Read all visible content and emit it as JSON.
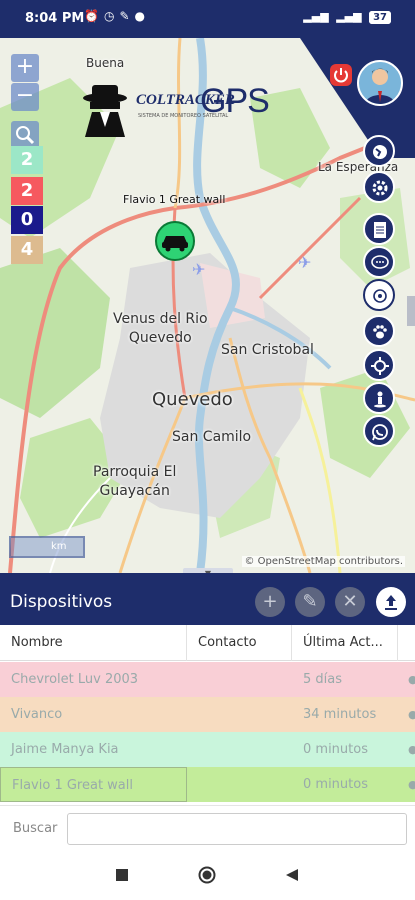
{
  "status_bar": {
    "time": "8:04 PM",
    "icons": [
      "alarm-icon",
      "clock-icon",
      "wrench-icon",
      "notification-icon"
    ],
    "battery": "37"
  },
  "map": {
    "logo": {
      "brand": "COLTRACKER",
      "suffix": "GPS",
      "tagline": "SISTEMA DE MONITOREO SATELITAL"
    },
    "zoom_in": "+",
    "zoom_out": "−",
    "counts": [
      {
        "value": "2",
        "color": "#9ce7c7"
      },
      {
        "value": "2",
        "color": "#f6595f"
      },
      {
        "value": "0",
        "color": "#1a1a8c"
      },
      {
        "value": "4",
        "color": "#ddbb8f"
      }
    ],
    "places": [
      {
        "text": "Buena"
      },
      {
        "text": "La Esperanza"
      },
      {
        "text": "Venus del Rio\nQuevedo"
      },
      {
        "text": "San Cristobal"
      },
      {
        "text": "Quevedo"
      },
      {
        "text": "San Camilo"
      },
      {
        "text": "Parroquia El\nGuayacán"
      }
    ],
    "vehicle_label": "Flavio 1 Great wall",
    "scale": "km",
    "attribution": "© OpenStreetMap contributors.",
    "colors": {
      "accent": "#1e2d6b",
      "road_major": "#ee8c7d",
      "road_secondary": "#f6c888",
      "river": "#a9cce3",
      "urban": "#dcdcdc",
      "forest": "#bfe2a6"
    }
  },
  "devices": {
    "title": "Dispositivos",
    "actions": [
      "add-icon",
      "edit-icon",
      "delete-icon",
      "upload-icon"
    ],
    "columns": [
      "Nombre",
      "Contacto",
      "Última Act..."
    ],
    "rows": [
      {
        "name": "Chevrolet Luv 2003",
        "contact": "",
        "last": "5 días",
        "color": "#f9cfd6"
      },
      {
        "name": "Vivanco",
        "contact": "",
        "last": "34 minutos",
        "color": "#f7dcc0"
      },
      {
        "name": "Jaime Manya Kia",
        "contact": "",
        "last": "0 minutos",
        "color": "#c9f5dc"
      },
      {
        "name": "Flavio 1 Great wall",
        "contact": "",
        "last": "0 minutos",
        "color": "#c3ec9a"
      }
    ],
    "search_label": "Buscar",
    "search_value": ""
  },
  "nav": {
    "buttons": [
      "recents-button",
      "home-button",
      "back-button"
    ]
  }
}
